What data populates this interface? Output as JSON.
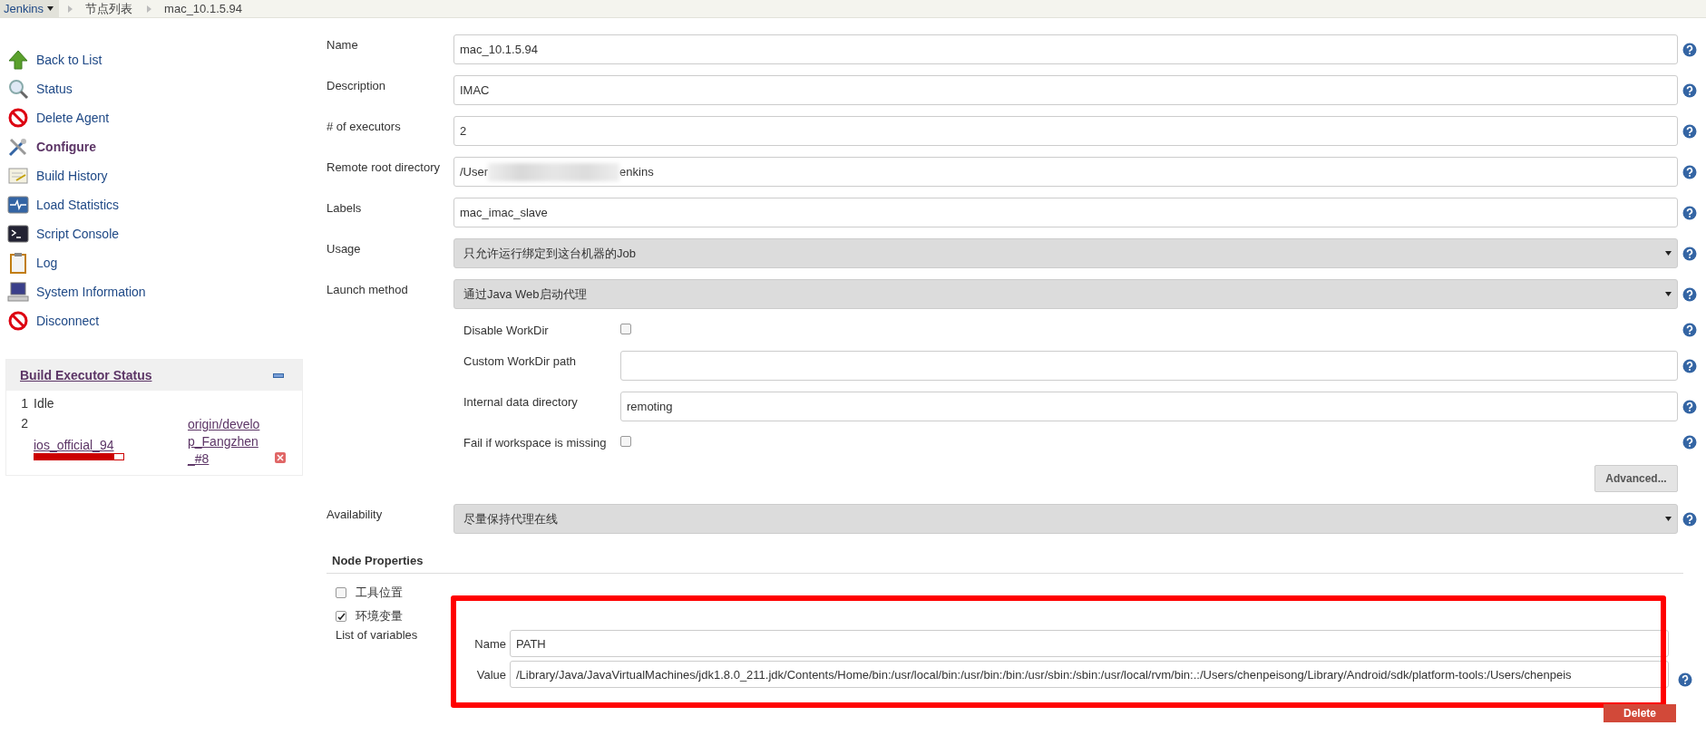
{
  "breadcrumb": [
    {
      "label": "Jenkins",
      "kind": "menu"
    },
    {
      "label": "节点列表",
      "kind": "crumb"
    },
    {
      "label": "mac_10.1.5.94",
      "kind": "crumb"
    }
  ],
  "sidebar": {
    "items": [
      {
        "label": "Back to List",
        "selected": false
      },
      {
        "label": "Status",
        "selected": false
      },
      {
        "label": "Delete Agent",
        "selected": false
      },
      {
        "label": "Configure",
        "selected": true
      },
      {
        "label": "Build History",
        "selected": false
      },
      {
        "label": "Load Statistics",
        "selected": false
      },
      {
        "label": "Script Console",
        "selected": false
      },
      {
        "label": "Log",
        "selected": false
      },
      {
        "label": "System Information",
        "selected": false
      },
      {
        "label": "Disconnect",
        "selected": false
      }
    ]
  },
  "executors": {
    "title": "Build Executor Status",
    "rows": [
      {
        "number": "1",
        "status": "Idle"
      },
      {
        "number": "2",
        "job": "ios_official_94",
        "level": 0.9,
        "branch": "origin/develop_Fangzhen_#8"
      }
    ]
  },
  "form": {
    "fields": [
      {
        "kind": "text",
        "label": "Name",
        "value": "mac_10.1.5.94"
      },
      {
        "kind": "text",
        "label": "Description",
        "value": "IMAC"
      },
      {
        "kind": "text",
        "label": "# of executors",
        "value": "2"
      },
      {
        "kind": "redacted",
        "label": "Remote root directory",
        "value_start": "/User",
        "value_end": "enkins"
      },
      {
        "kind": "text",
        "label": "Labels",
        "value": "mac_imac_slave"
      },
      {
        "kind": "select",
        "label": "Usage",
        "value": "只允许运行绑定到这台机器的Job"
      },
      {
        "kind": "select",
        "label": "Launch method",
        "value": "通过Java Web启动代理"
      },
      {
        "kind": "sub_checkbox",
        "label": "Disable WorkDir",
        "checked": false
      },
      {
        "kind": "sub_text",
        "label": "Custom WorkDir path"
      },
      {
        "kind": "sub_text",
        "label": "Internal data directory",
        "value": "remoting"
      },
      {
        "kind": "sub_checkbox",
        "label": "Fail if workspace is missing",
        "checked": false
      },
      {
        "kind": "button",
        "label": "Advanced..."
      },
      {
        "kind": "select",
        "label": "Availability",
        "value": "尽量保持代理在线"
      }
    ]
  },
  "node_properties": {
    "title": "Node Properties",
    "items": [
      {
        "label": "工具位置",
        "checked": false
      },
      {
        "label": "环境变量",
        "checked": true
      }
    ],
    "list_label": "List of variables",
    "variables": [
      {
        "label": "Name",
        "value": "PATH"
      },
      {
        "label": "Value",
        "value": "/Library/Java/JavaVirtualMachines/jdk1.8.0_211.jdk/Contents/Home/bin:/usr/local/bin:/usr/bin:/bin:/usr/sbin:/sbin:/usr/local/rvm/bin:.:/Users/chenpeisong/Library/Android/sdk/platform-tools:/Users/chenpeis"
      }
    ],
    "delete_button": "Delete"
  }
}
